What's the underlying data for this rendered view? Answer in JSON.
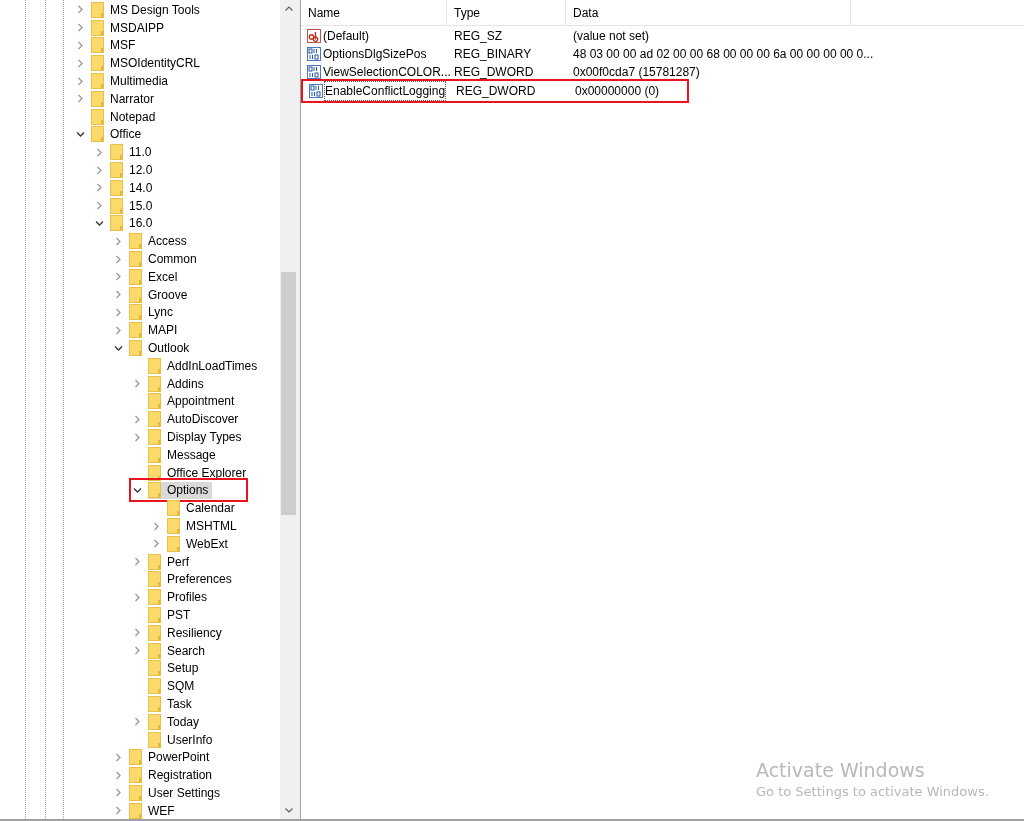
{
  "tree": [
    {
      "label": "MS Design Tools",
      "expandable": true,
      "expanded": false,
      "selected": false,
      "marked": false
    },
    {
      "label": "MSDAIPP",
      "expandable": true,
      "expanded": false,
      "selected": false,
      "marked": false
    },
    {
      "label": "MSF",
      "expandable": true,
      "expanded": false,
      "selected": false,
      "marked": false
    },
    {
      "label": "MSOIdentityCRL",
      "expandable": true,
      "expanded": false,
      "selected": false,
      "marked": false
    },
    {
      "label": "Multimedia",
      "expandable": true,
      "expanded": false,
      "selected": false,
      "marked": false
    },
    {
      "label": "Narrator",
      "expandable": true,
      "expanded": false,
      "selected": false,
      "marked": false
    },
    {
      "label": "Notepad",
      "expandable": false,
      "selected": false,
      "marked": false
    },
    {
      "label": "Office",
      "expandable": true,
      "expanded": true,
      "selected": false,
      "marked": false,
      "children": [
        {
          "label": "11.0",
          "expandable": true,
          "expanded": false,
          "selected": false,
          "marked": false
        },
        {
          "label": "12.0",
          "expandable": true,
          "expanded": false,
          "selected": false,
          "marked": false
        },
        {
          "label": "14.0",
          "expandable": true,
          "expanded": false,
          "selected": false,
          "marked": false
        },
        {
          "label": "15.0",
          "expandable": true,
          "expanded": false,
          "selected": false,
          "marked": false
        },
        {
          "label": "16.0",
          "expandable": true,
          "expanded": true,
          "selected": false,
          "marked": false,
          "children": [
            {
              "label": "Access",
              "expandable": true,
              "expanded": false,
              "selected": false,
              "marked": false
            },
            {
              "label": "Common",
              "expandable": true,
              "expanded": false,
              "selected": false,
              "marked": false
            },
            {
              "label": "Excel",
              "expandable": true,
              "expanded": false,
              "selected": false,
              "marked": false
            },
            {
              "label": "Groove",
              "expandable": true,
              "expanded": false,
              "selected": false,
              "marked": false
            },
            {
              "label": "Lync",
              "expandable": true,
              "expanded": false,
              "selected": false,
              "marked": false
            },
            {
              "label": "MAPI",
              "expandable": true,
              "expanded": false,
              "selected": false,
              "marked": false
            },
            {
              "label": "Outlook",
              "expandable": true,
              "expanded": true,
              "selected": false,
              "marked": false,
              "children": [
                {
                  "label": "AddInLoadTimes",
                  "expandable": false,
                  "selected": false,
                  "marked": false
                },
                {
                  "label": "Addins",
                  "expandable": true,
                  "expanded": false,
                  "selected": false,
                  "marked": false
                },
                {
                  "label": "Appointment",
                  "expandable": false,
                  "selected": false,
                  "marked": false
                },
                {
                  "label": "AutoDiscover",
                  "expandable": true,
                  "expanded": false,
                  "selected": false,
                  "marked": false
                },
                {
                  "label": "Display Types",
                  "expandable": true,
                  "expanded": false,
                  "selected": false,
                  "marked": false
                },
                {
                  "label": "Message",
                  "expandable": false,
                  "selected": false,
                  "marked": false
                },
                {
                  "label": "Office Explorer",
                  "expandable": false,
                  "selected": false,
                  "marked": false
                },
                {
                  "label": "Options",
                  "expandable": true,
                  "expanded": true,
                  "selected": true,
                  "marked": true,
                  "children": [
                    {
                      "label": "Calendar",
                      "expandable": false,
                      "selected": false,
                      "marked": false
                    },
                    {
                      "label": "MSHTML",
                      "expandable": true,
                      "expanded": false,
                      "selected": false,
                      "marked": false
                    },
                    {
                      "label": "WebExt",
                      "expandable": true,
                      "expanded": false,
                      "selected": false,
                      "marked": false
                    }
                  ]
                },
                {
                  "label": "Perf",
                  "expandable": true,
                  "expanded": false,
                  "selected": false,
                  "marked": false
                },
                {
                  "label": "Preferences",
                  "expandable": false,
                  "selected": false,
                  "marked": false
                },
                {
                  "label": "Profiles",
                  "expandable": true,
                  "expanded": false,
                  "selected": false,
                  "marked": false
                },
                {
                  "label": "PST",
                  "expandable": false,
                  "selected": false,
                  "marked": false
                },
                {
                  "label": "Resiliency",
                  "expandable": true,
                  "expanded": false,
                  "selected": false,
                  "marked": false
                },
                {
                  "label": "Search",
                  "expandable": true,
                  "expanded": false,
                  "selected": false,
                  "marked": false
                },
                {
                  "label": "Setup",
                  "expandable": false,
                  "selected": false,
                  "marked": false
                },
                {
                  "label": "SQM",
                  "expandable": false,
                  "selected": false,
                  "marked": false
                },
                {
                  "label": "Task",
                  "expandable": false,
                  "selected": false,
                  "marked": false
                },
                {
                  "label": "Today",
                  "expandable": true,
                  "expanded": false,
                  "selected": false,
                  "marked": false
                },
                {
                  "label": "UserInfo",
                  "expandable": false,
                  "selected": false,
                  "marked": false
                }
              ]
            },
            {
              "label": "PowerPoint",
              "expandable": true,
              "expanded": false,
              "selected": false,
              "marked": false
            },
            {
              "label": "Registration",
              "expandable": true,
              "expanded": false,
              "selected": false,
              "marked": false
            },
            {
              "label": "User Settings",
              "expandable": true,
              "expanded": false,
              "selected": false,
              "marked": false
            },
            {
              "label": "WEF",
              "expandable": true,
              "expanded": false,
              "selected": false,
              "marked": false
            }
          ]
        }
      ]
    }
  ],
  "values": {
    "columns": [
      "Name",
      "Type",
      "Data"
    ],
    "rows": [
      {
        "kind": "string",
        "name": "(Default)",
        "type": "REG_SZ",
        "data": "(value not set)",
        "focused": false,
        "marked": false
      },
      {
        "kind": "binary",
        "name": "OptionsDlgSizePos",
        "type": "REG_BINARY",
        "data": "48 03 00 00 ad 02 00 00 68 00 00 00 6a 00 00 00 00 0...",
        "focused": false,
        "marked": false
      },
      {
        "kind": "binary",
        "name": "ViewSelectionCOLOR...",
        "type": "REG_DWORD",
        "data": "0x00f0cda7 (15781287)",
        "focused": false,
        "marked": false
      },
      {
        "kind": "binary",
        "name": "EnableConflictLogging",
        "type": "REG_DWORD",
        "data": "0x00000000 (0)",
        "focused": true,
        "marked": true
      }
    ]
  },
  "activation": {
    "title": "Activate Windows",
    "message": "Go to Settings to activate Windows."
  }
}
